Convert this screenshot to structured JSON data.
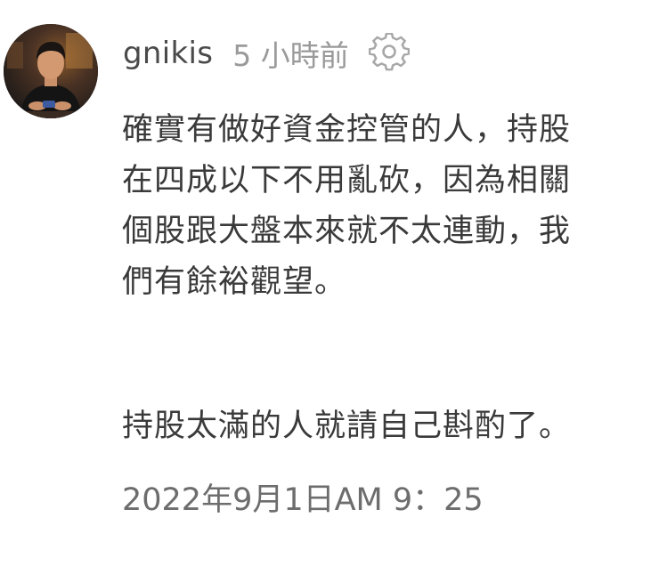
{
  "comment": {
    "username": "gnikis",
    "time_ago": "5 小時前",
    "settings_icon": "gear-icon",
    "body_lines": [
      "確實有做好資金控管的人，持股",
      "在四成以下不用亂砍，因為相關",
      "個股跟大盤本來就不太連動，我",
      "們有餘裕觀望。"
    ],
    "body_paragraph_2": "持股太滿的人就請自己斟酌了。",
    "timestamp": "2022年9月1日AM 9：25"
  },
  "colors": {
    "username": "#4a4a4a",
    "time_ago": "#9a9a9a",
    "body_text": "#3a3a3a",
    "timestamp": "#6d6d6d",
    "icon": "#a8a8a8"
  }
}
